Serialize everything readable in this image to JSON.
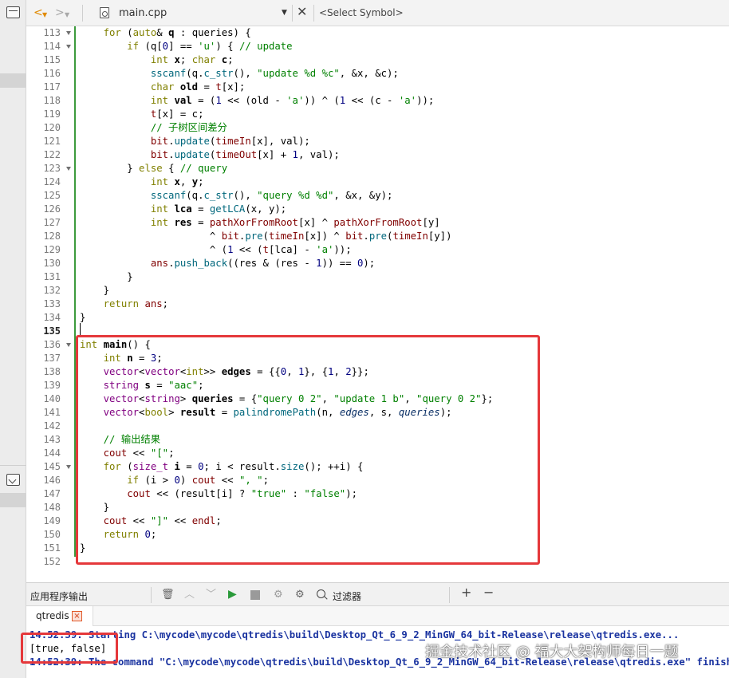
{
  "toolbar": {
    "back_glyph": "<",
    "forward_glyph": ">",
    "file_name": "main.cpp",
    "symbol_placeholder": "<Select Symbol>"
  },
  "editor": {
    "lines": [
      {
        "n": "113",
        "fold": true,
        "html": "    <span class='kw'>for</span> (<span class='kw'>auto</span>&amp; <span class='vb'>q</span> : queries) {"
      },
      {
        "n": "114",
        "fold": true,
        "html": "        <span class='kw'>if</span> (q[<span class='nm'>0</span>] == <span class='st'>'u'</span>) { <span class='cm'>// update</span>"
      },
      {
        "n": "115",
        "fold": false,
        "html": "            <span class='kw'>int</span> <span class='vb'>x</span>; <span class='kw'>char</span> <span class='vb'>c</span>;"
      },
      {
        "n": "116",
        "fold": false,
        "html": "            <span class='fn'>sscanf</span>(q.<span class='fn'>c_str</span>(), <span class='st'>\"update %d %c\"</span>, &amp;x, &amp;c);"
      },
      {
        "n": "117",
        "fold": false,
        "html": "            <span class='kw'>char</span> <span class='vb'>old</span> = <span class='fd'>t</span>[x];"
      },
      {
        "n": "118",
        "fold": false,
        "html": "            <span class='kw'>int</span> <span class='vb'>val</span> = (<span class='nm'>1</span> &lt;&lt; (old - <span class='st'>'a'</span>)) ^ (<span class='nm'>1</span> &lt;&lt; (c - <span class='st'>'a'</span>));"
      },
      {
        "n": "119",
        "fold": false,
        "html": "            <span class='fd'>t</span>[x] = c;"
      },
      {
        "n": "120",
        "fold": false,
        "html": "            <span class='cm'>// 子树区间差分</span>"
      },
      {
        "n": "121",
        "fold": false,
        "html": "            <span class='fd'>bit</span>.<span class='fn'>update</span>(<span class='fd'>timeIn</span>[x], val);"
      },
      {
        "n": "122",
        "fold": false,
        "html": "            <span class='fd'>bit</span>.<span class='fn'>update</span>(<span class='fd'>timeOut</span>[x] + <span class='nm'>1</span>, val);"
      },
      {
        "n": "123",
        "fold": true,
        "html": "        } <span class='kw'>else</span> { <span class='cm'>// query</span>"
      },
      {
        "n": "124",
        "fold": false,
        "html": "            <span class='kw'>int</span> <span class='vb'>x</span>, <span class='vb'>y</span>;"
      },
      {
        "n": "125",
        "fold": false,
        "html": "            <span class='fn'>sscanf</span>(q.<span class='fn'>c_str</span>(), <span class='st'>\"query %d %d\"</span>, &amp;x, &amp;y);"
      },
      {
        "n": "126",
        "fold": false,
        "html": "            <span class='kw'>int</span> <span class='vb'>lca</span> = <span class='fn'>getLCA</span>(x, y);"
      },
      {
        "n": "127",
        "fold": false,
        "html": "            <span class='kw'>int</span> <span class='vb'>res</span> = <span class='fd'>pathXorFromRoot</span>[x] ^ <span class='fd'>pathXorFromRoot</span>[y]"
      },
      {
        "n": "128",
        "fold": false,
        "html": "                      ^ <span class='fd'>bit</span>.<span class='fn'>pre</span>(<span class='fd'>timeIn</span>[x]) ^ <span class='fd'>bit</span>.<span class='fn'>pre</span>(<span class='fd'>timeIn</span>[y])"
      },
      {
        "n": "129",
        "fold": false,
        "html": "                      ^ (<span class='nm'>1</span> &lt;&lt; (<span class='fd'>t</span>[lca] - <span class='st'>'a'</span>));"
      },
      {
        "n": "130",
        "fold": false,
        "html": "            <span class='fd'>ans</span>.<span class='fn'>push_back</span>((res &amp; (res - <span class='nm'>1</span>)) == <span class='nm'>0</span>);"
      },
      {
        "n": "131",
        "fold": false,
        "html": "        }"
      },
      {
        "n": "132",
        "fold": false,
        "html": "    }"
      },
      {
        "n": "133",
        "fold": false,
        "html": "    <span class='kw'>return</span> <span class='fd'>ans</span>;"
      },
      {
        "n": "134",
        "fold": false,
        "html": "}"
      },
      {
        "n": "135",
        "fold": false,
        "html": ""
      },
      {
        "n": "136",
        "fold": true,
        "html": "<span class='kw'>int</span> <span class='vb'>main</span>() {"
      },
      {
        "n": "137",
        "fold": false,
        "html": "    <span class='kw'>int</span> <span class='vb'>n</span> = <span class='nm'>3</span>;"
      },
      {
        "n": "138",
        "fold": false,
        "html": "    <span class='ty'>vector</span>&lt;<span class='ty'>vector</span>&lt;<span class='kw'>int</span>&gt;&gt; <span class='vb'>edges</span> = {{<span class='nm'>0</span>, <span class='nm'>1</span>}, {<span class='nm'>1</span>, <span class='nm'>2</span>}};"
      },
      {
        "n": "139",
        "fold": false,
        "html": "    <span class='ty'>string</span> <span class='vb'>s</span> = <span class='st'>\"aac\"</span>;"
      },
      {
        "n": "140",
        "fold": false,
        "html": "    <span class='ty'>vector</span>&lt;<span class='ty'>string</span>&gt; <span class='vb'>queries</span> = {<span class='st'>\"query 0 2\"</span>, <span class='st'>\"update 1 b\"</span>, <span class='st'>\"query 0 2\"</span>};"
      },
      {
        "n": "141",
        "fold": false,
        "html": "    <span class='ty'>vector</span>&lt;<span class='kw'>bool</span>&gt; <span class='vb'>result</span> = <span class='fn'>palindromePath</span>(n, <span class='pm'>edges</span>, s, <span class='pm'>queries</span>);"
      },
      {
        "n": "142",
        "fold": false,
        "html": ""
      },
      {
        "n": "143",
        "fold": false,
        "html": "    <span class='cm'>// 输出结果</span>"
      },
      {
        "n": "144",
        "fold": false,
        "html": "    <span class='fd'>cout</span> &lt;&lt; <span class='st'>\"[\"</span>;"
      },
      {
        "n": "145",
        "fold": true,
        "html": "    <span class='kw'>for</span> (<span class='ty'>size_t</span> <span class='vb'>i</span> = <span class='nm'>0</span>; i &lt; result.<span class='fn'>size</span>(); ++i) {"
      },
      {
        "n": "146",
        "fold": false,
        "html": "        <span class='kw'>if</span> (i &gt; <span class='nm'>0</span>) <span class='fd'>cout</span> &lt;&lt; <span class='st'>\", \"</span>;"
      },
      {
        "n": "147",
        "fold": false,
        "html": "        <span class='fd'>cout</span> &lt;&lt; (result[i] ? <span class='st'>\"true\"</span> : <span class='st'>\"false\"</span>);"
      },
      {
        "n": "148",
        "fold": false,
        "html": "    }"
      },
      {
        "n": "149",
        "fold": false,
        "html": "    <span class='fd'>cout</span> &lt;&lt; <span class='st'>\"]\"</span> &lt;&lt; <span class='fd'>endl</span>;"
      },
      {
        "n": "150",
        "fold": false,
        "html": "    <span class='kw'>return</span> <span class='nm'>0</span>;"
      },
      {
        "n": "151",
        "fold": false,
        "html": "}"
      },
      {
        "n": "152",
        "fold": false,
        "html": ""
      }
    ],
    "active_line": "135"
  },
  "output": {
    "title": "应用程序输出",
    "filter_label": "过滤器",
    "add_glyph": "+",
    "remove_glyph": "−",
    "tab_label": "qtredis",
    "tab_close_glyph": "×",
    "line1": "14:52:39: Starting C:\\mycode\\mycode\\qtredis\\build\\Desktop_Qt_6_9_2_MinGW_64_bit-Release\\release\\qtredis.exe...",
    "line2": "[true, false]",
    "line3": "14:52:39: The command \"C:\\mycode\\mycode\\qtredis\\build\\Desktop_Qt_6_9_2_MinGW_64_bit-Release\\release\\qtredis.exe\" finished successfully."
  },
  "watermark": "掘金技术社区 @ 福大大架构师每日一题",
  "icons": {
    "toolbar": [
      "back-arrow-icon",
      "forward-arrow-icon",
      "file-icon",
      "close-icon"
    ],
    "output": [
      "trash-icon",
      "up-arrow-icon",
      "down-arrow-icon",
      "run-icon",
      "stop-icon",
      "debug-icon",
      "settings-icon",
      "search-icon"
    ]
  },
  "colors": {
    "highlight": "#e5383b",
    "keyword": "#808000",
    "string": "#008000",
    "change_marker": "#3c9a3c"
  }
}
